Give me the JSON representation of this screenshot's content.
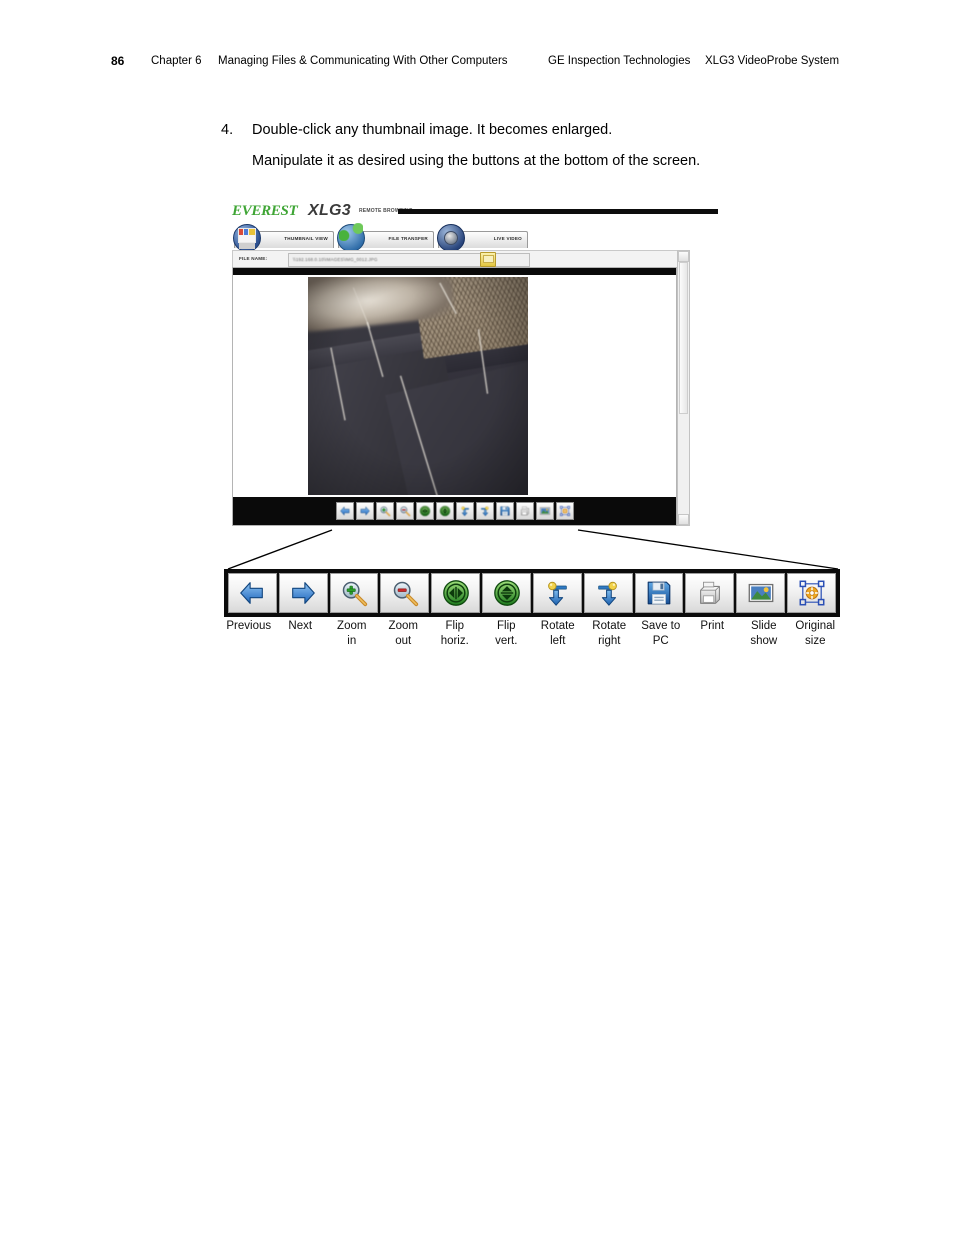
{
  "header": {
    "page_number": "86",
    "chapter": "Chapter 6",
    "chapter_title": "Managing Files & Communicating With Other Computers",
    "company": "GE Inspection Technologies",
    "product": "XLG3 VideoProbe System"
  },
  "step": {
    "number": "4.",
    "line1": "Double-click any thumbnail image. It becomes enlarged.",
    "line2": "Manipulate it as desired using the buttons at the bottom of the screen."
  },
  "screenshot": {
    "brand": {
      "everest": "EVEREST",
      "model": "XLG3",
      "subtitle": "REMOTE BROWSING"
    },
    "tabs": [
      {
        "label": "THUMBNAIL VIEW",
        "icon": "thumbnail-view-icon"
      },
      {
        "label": "FILE TRANSFER",
        "icon": "file-transfer-icon"
      },
      {
        "label": "LIVE VIDEO",
        "icon": "live-video-icon"
      }
    ],
    "file_row": {
      "label": "FILE NAME:",
      "value": "\\\\192.168.0.10\\IMAGES\\IMG_0012.JPG",
      "browse_icon": "folder-browse-icon"
    },
    "photo_alt": "Enlarged borescope inspection image of turbine blades with honeycomb seal",
    "scrollbar": {
      "up_icon": "scroll-up-arrow-icon",
      "down_icon": "scroll-down-arrow-icon"
    }
  },
  "toolbar": {
    "buttons": [
      {
        "label_line1": "Previous",
        "label_line2": "",
        "icon": "previous-arrow-icon"
      },
      {
        "label_line1": "Next",
        "label_line2": "",
        "icon": "next-arrow-icon"
      },
      {
        "label_line1": "Zoom",
        "label_line2": "in",
        "icon": "zoom-in-icon"
      },
      {
        "label_line1": "Zoom",
        "label_line2": "out",
        "icon": "zoom-out-icon"
      },
      {
        "label_line1": "Flip",
        "label_line2": "horiz.",
        "icon": "flip-horizontal-icon"
      },
      {
        "label_line1": "Flip",
        "label_line2": "vert.",
        "icon": "flip-vertical-icon"
      },
      {
        "label_line1": "Rotate",
        "label_line2": "left",
        "icon": "rotate-left-icon"
      },
      {
        "label_line1": "Rotate",
        "label_line2": "right",
        "icon": "rotate-right-icon"
      },
      {
        "label_line1": "Save to",
        "label_line2": "PC",
        "icon": "save-floppy-icon"
      },
      {
        "label_line1": "Print",
        "label_line2": "",
        "icon": "printer-icon"
      },
      {
        "label_line1": "Slide",
        "label_line2": "show",
        "icon": "slideshow-picture-icon"
      },
      {
        "label_line1": "Original",
        "label_line2": "size",
        "icon": "original-size-icon"
      }
    ]
  },
  "colors": {
    "brand_green": "#3fa535",
    "brand_dark": "#3a3a3a",
    "toolbar_background": "#0b0b0b",
    "arrow_blue": "#2f7fd4",
    "flip_green": "#2f9b2f",
    "page_text": "#000000"
  }
}
